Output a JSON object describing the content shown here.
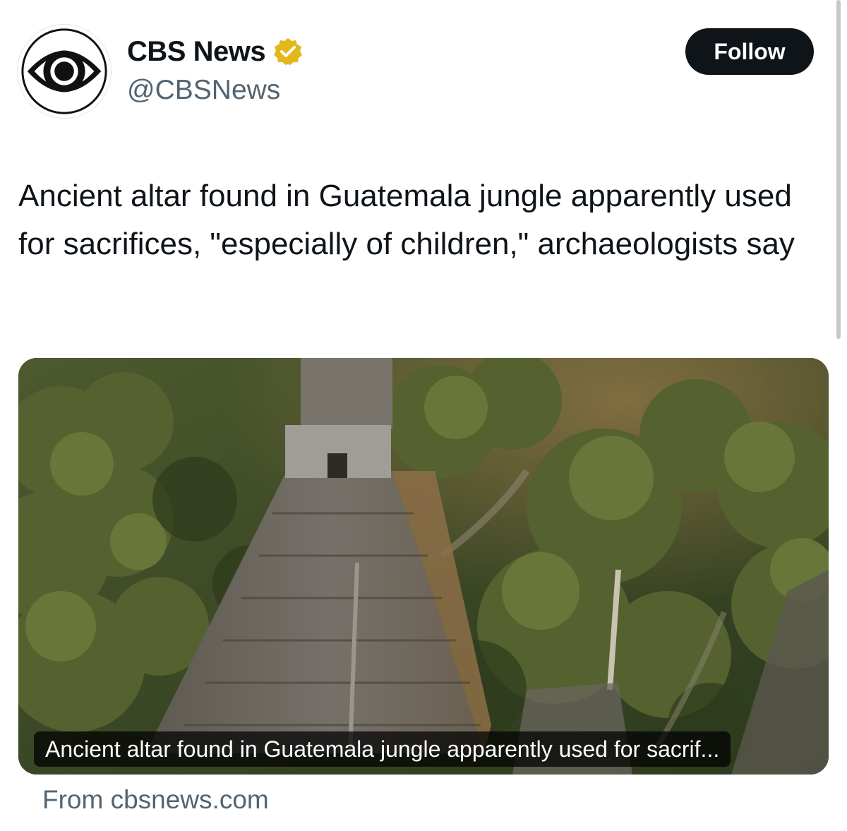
{
  "author": {
    "display_name": "CBS News",
    "handle": "@CBSNews",
    "verified_badge": "gold-verified-badge-icon",
    "avatar": "cbs-eye-logo-icon"
  },
  "actions": {
    "follow_label": "Follow"
  },
  "post": {
    "text": "Ancient altar found in Guatemala jungle apparently used for sacrifices, \"especially of children,\" archaeologists say"
  },
  "link_card": {
    "image": "aerial photo of Mayan pyramid in jungle",
    "caption": "Ancient altar found in Guatemala jungle apparently used for sacrif...",
    "source": "From cbsnews.com"
  },
  "colors": {
    "text": "#0f1419",
    "secondary_text": "#536471",
    "button_bg": "#0f1419",
    "badge_gold": "#e2b719"
  }
}
